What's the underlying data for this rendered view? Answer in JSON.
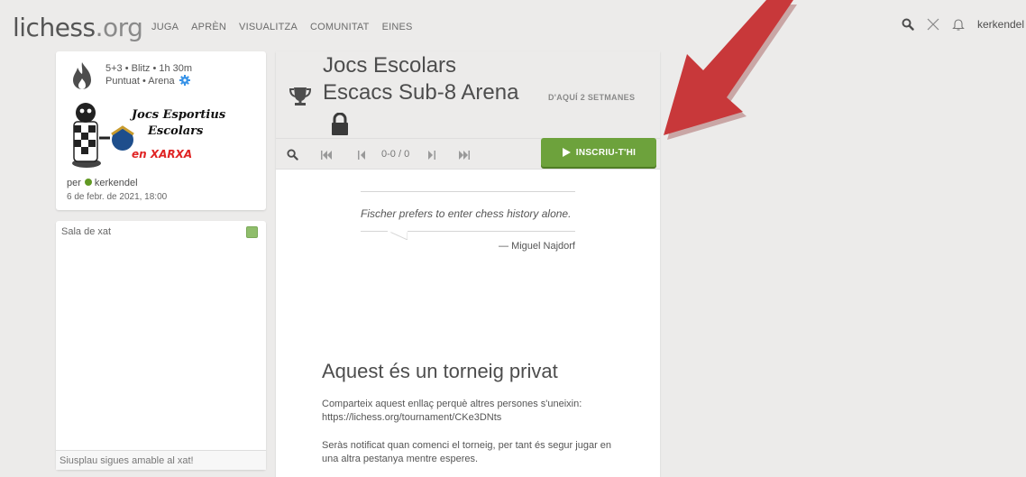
{
  "topbar": {
    "logo_main": "lichess",
    "logo_tld": ".org",
    "nav": [
      "JUGA",
      "APRÈN",
      "VISUALITZA",
      "COMUNITAT",
      "EINES"
    ],
    "username": "kerkendel",
    "icons": [
      "search-icon",
      "swords-icon",
      "bell-icon"
    ]
  },
  "tournament": {
    "setup_line1": "5+3 • Blitz • 1h 30m",
    "setup_line2": "Puntuat • Arena",
    "logo_text1": "Jocs Esportius",
    "logo_text2": "Escolars",
    "logo_text3": "en XARXA",
    "by_prefix": "per",
    "creator": "kerkendel",
    "date": "6 de febr. de 2021, 18:00",
    "title_line1": "Jocs Escolars",
    "title_line2": "Escacs Sub-8 Arena",
    "starts_in": "D'AQUÍ 2 SETMANES"
  },
  "chat": {
    "title": "Sala de xat",
    "input_placeholder": "Siusplau sigues amable al xat!"
  },
  "controls": {
    "pager": "0-0 / 0",
    "join_label": "INSCRIU-T'HI"
  },
  "quote": {
    "text": "Fischer prefers to enter chess history alone.",
    "author": "— Miguel Najdorf"
  },
  "private": {
    "title": "Aquest és un torneig privat",
    "p1": "Comparteix aquest enllaç perquè altres persones s'uneixin: https://lichess.org/tournament/CKe3DNts",
    "p2": "Seràs notificat quan comenci el torneig, per tant és segur jugar en una altra pestanya mentre esperes."
  },
  "colors": {
    "join_button": "#6da23c",
    "online_dot": "#629924",
    "arrow": "#c8383a"
  }
}
